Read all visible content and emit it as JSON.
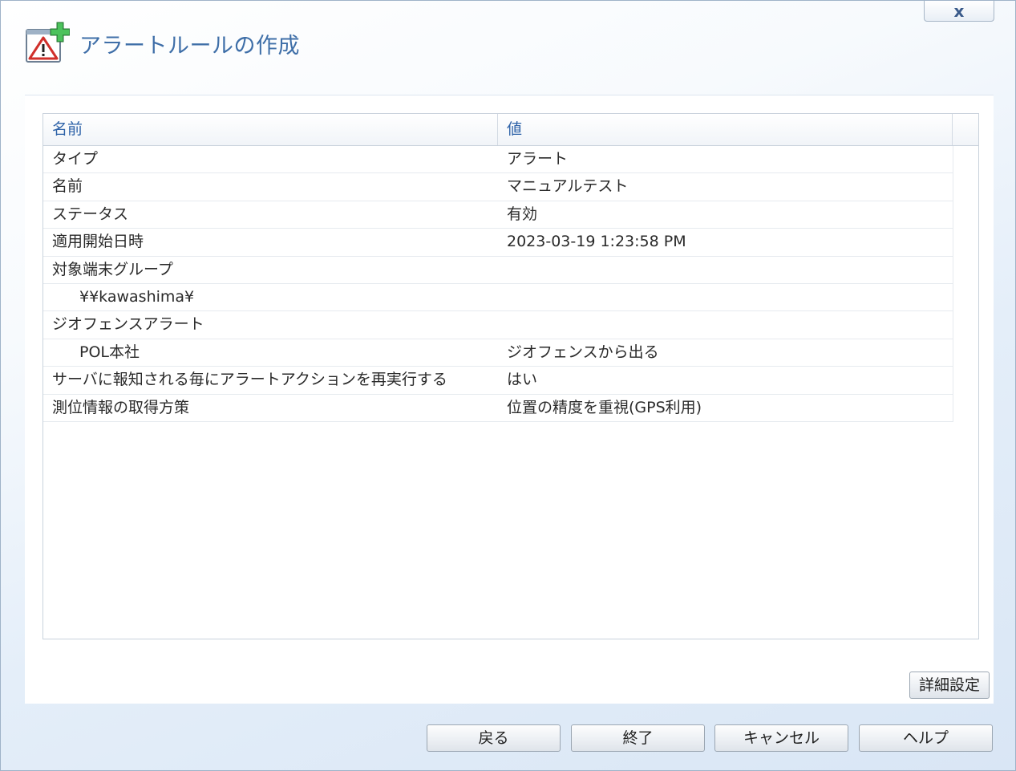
{
  "dialog": {
    "title": "アラートルールの作成",
    "close_label": "x"
  },
  "grid": {
    "columns": [
      "名前",
      "値"
    ],
    "rows": [
      {
        "key": "タイプ",
        "value": "アラート",
        "indent": false
      },
      {
        "key": "名前",
        "value": "マニュアルテスト",
        "indent": false
      },
      {
        "key": "ステータス",
        "value": "有効",
        "indent": false
      },
      {
        "key": "適用開始日時",
        "value": "2023-03-19 1:23:58 PM",
        "indent": false
      },
      {
        "key": "対象端末グループ",
        "value": "",
        "indent": false
      },
      {
        "key": "¥¥kawashima¥",
        "value": "",
        "indent": true
      },
      {
        "key": "ジオフェンスアラート",
        "value": "",
        "indent": false
      },
      {
        "key": "POL本社",
        "value": "ジオフェンスから出る",
        "indent": true
      },
      {
        "key": "サーバに報知される毎にアラートアクションを再実行する",
        "value": "はい",
        "indent": false
      },
      {
        "key": "測位情報の取得方策",
        "value": "位置の精度を重視(GPS利用)",
        "indent": false
      }
    ]
  },
  "buttons": {
    "detail": "詳細設定",
    "back": "戻る",
    "finish": "終了",
    "cancel": "キャンセル",
    "help": "ヘルプ"
  },
  "icons": {
    "title_icon": "alert-add-icon",
    "close": "close-icon"
  },
  "colors": {
    "title": "#3f6fa8",
    "header_text": "#2e62a8",
    "warning_red": "#d0302b",
    "add_green": "#3aa64a"
  }
}
